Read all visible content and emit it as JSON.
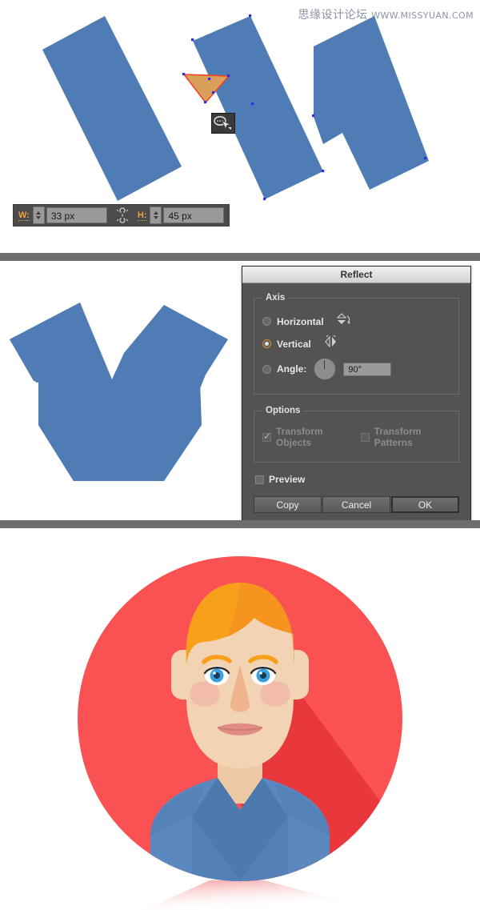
{
  "watermark": {
    "chinese": "思缘设计论坛",
    "url": "WWW.MISSYUAN.COM"
  },
  "panel_shapes": {
    "name": "illustrator-canvas-shapes",
    "shape_fill": "#4f7cb4",
    "selection_color": "#2d2df0",
    "highlight_fill": "#d8a05a",
    "highlight_stroke": "#f4441f",
    "toolbar": {
      "width_label": "W:",
      "width_value": "33 px",
      "height_label": "H:",
      "height_value": "45 px",
      "link_icon": "constrain-proportions-icon",
      "background": "#4b4b4b",
      "label_color": "#e8a33d"
    },
    "cursor_badge_icon": "lasso-cursor-icon"
  },
  "panel_reflect": {
    "shape_fill": "#4f7cb4",
    "dialog": {
      "title": "Reflect",
      "axis_group_label": "Axis",
      "axis_options": [
        {
          "label": "Horizontal",
          "selected": false,
          "icon": "reflect-horizontal-icon"
        },
        {
          "label": "Vertical",
          "selected": true,
          "icon": "reflect-vertical-icon"
        }
      ],
      "angle_label": "Angle:",
      "angle_value": "90°",
      "angle_selected": false,
      "options_group_label": "Options",
      "options": [
        {
          "label": "Transform Objects",
          "checked": true,
          "disabled": true
        },
        {
          "label": "Transform Patterns",
          "checked": false,
          "disabled": true
        }
      ],
      "preview_label": "Preview",
      "preview_checked": false,
      "buttons": [
        {
          "label": "Copy",
          "primary": false
        },
        {
          "label": "Cancel",
          "primary": false
        },
        {
          "label": "OK",
          "primary": true
        }
      ],
      "accent_color": "#d98a2b"
    }
  },
  "panel_avatar": {
    "name": "flat-avatar-illustration",
    "colors": {
      "circle_red": "#fa5153",
      "shadow_red": "#e8383c",
      "hair_orange": "#f9a01b",
      "hair_orange_dark": "#f5941f",
      "skin": "#f2d3b4",
      "skin_shade": "#eec9a6",
      "nose": "#f0b48f",
      "cheek": "#f0b3a6",
      "mouth": "#e08c84",
      "mouth_dark": "#cf7d78",
      "eye_white": "#ffffff",
      "eye_blue": "#3aa0e0",
      "eye_pupil": "#1b3a52",
      "shirt_blue": "#5b88be",
      "shirt_blue_dark": "#4c7aaf",
      "shirt_blue_darker": "#426d9e"
    }
  },
  "separator_color": "#6d6d6d"
}
